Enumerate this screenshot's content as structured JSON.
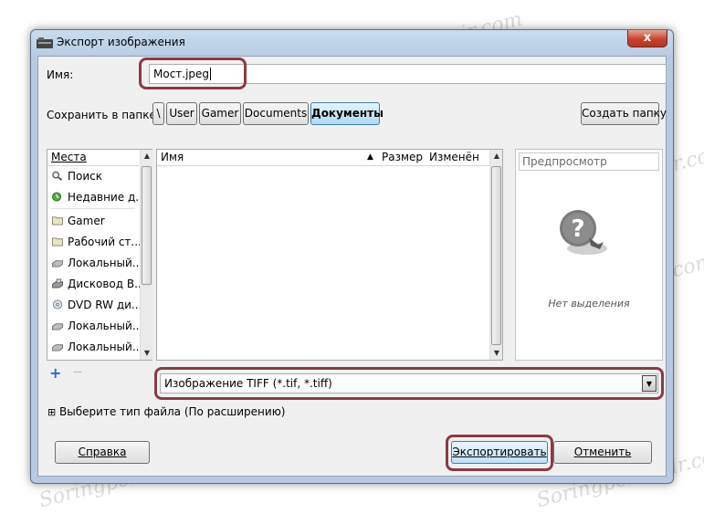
{
  "window": {
    "title": "Экспорт изображения",
    "close_glyph": "x"
  },
  "name_row": {
    "label": "Имя:",
    "value": "Мост.jpeg"
  },
  "save_in": {
    "label": "Сохранить в папке",
    "path_buttons": [
      "\\",
      "User",
      "Gamer",
      "Documents",
      "Документы"
    ],
    "create_folder": "Создать папку"
  },
  "places": {
    "header": "Места",
    "items": [
      {
        "label": "Поиск",
        "icon": "search-icon"
      },
      {
        "label": "Недавние д...",
        "icon": "recent-icon"
      },
      {
        "label": "Gamer",
        "icon": "folder-icon"
      },
      {
        "label": "Рабочий ст...",
        "icon": "folder-icon"
      },
      {
        "label": "Локальный...",
        "icon": "drive-icon"
      },
      {
        "label": "Дисковод В...",
        "icon": "floppy-icon"
      },
      {
        "label": "DVD RW ди...",
        "icon": "dvd-icon"
      },
      {
        "label": "Локальный...",
        "icon": "drive-icon"
      },
      {
        "label": "Локальный...",
        "icon": "drive-icon"
      }
    ],
    "add_glyph": "+",
    "remove_glyph": "—"
  },
  "files": {
    "col_name": "Имя",
    "col_size": "Размер",
    "col_modified": "Изменён"
  },
  "preview": {
    "header": "Предпросмотр",
    "empty_text": "Нет выделения"
  },
  "file_type": {
    "value": "Изображение TIFF (*.tif, *.tiff)"
  },
  "select_type": {
    "expander": "⊞",
    "label": "Выберите тип файла (По расширению)"
  },
  "buttons": {
    "help": "Справка",
    "export": "Экспортировать",
    "cancel": "Отменить"
  },
  "watermark": {
    "text": "Soringpcrepair.com"
  },
  "colors": {
    "highlight": "#8c3a43",
    "active_path": "#aed9f3",
    "close": "#c8442d"
  }
}
